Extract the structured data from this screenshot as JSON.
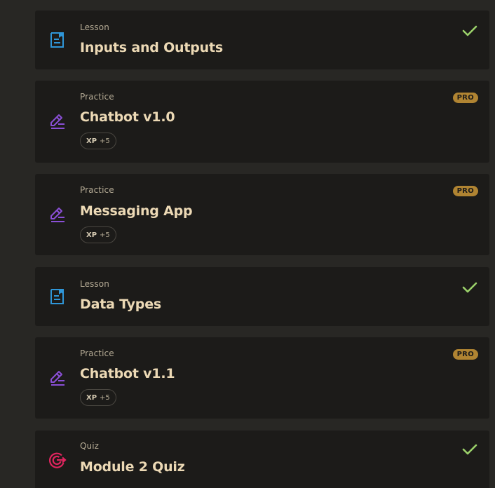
{
  "colors": {
    "background": "#282724",
    "card": "#1c1b19",
    "title": "#ecd9b5",
    "subtext": "#b4aa94",
    "lesson_icon": "#2f96d8",
    "practice_icon": "#8a4fd6",
    "quiz_icon": "#e0245e",
    "check": "#9bd16a",
    "pro_badge": "#b08432"
  },
  "items": [
    {
      "kind": "Lesson",
      "title": "Inputs and Outputs",
      "icon": "lesson-icon",
      "status": "completed"
    },
    {
      "kind": "Practice",
      "title": "Chatbot v1.0",
      "icon": "practice-icon",
      "badge": "PRO",
      "xp_label": "XP",
      "xp_value": "+5"
    },
    {
      "kind": "Practice",
      "title": "Messaging App",
      "icon": "practice-icon",
      "badge": "PRO",
      "xp_label": "XP",
      "xp_value": "+5"
    },
    {
      "kind": "Lesson",
      "title": "Data Types",
      "icon": "lesson-icon",
      "status": "completed"
    },
    {
      "kind": "Practice",
      "title": "Chatbot v1.1",
      "icon": "practice-icon",
      "badge": "PRO",
      "xp_label": "XP",
      "xp_value": "+5"
    },
    {
      "kind": "Quiz",
      "title": "Module 2 Quiz",
      "icon": "quiz-icon",
      "status": "completed"
    }
  ]
}
